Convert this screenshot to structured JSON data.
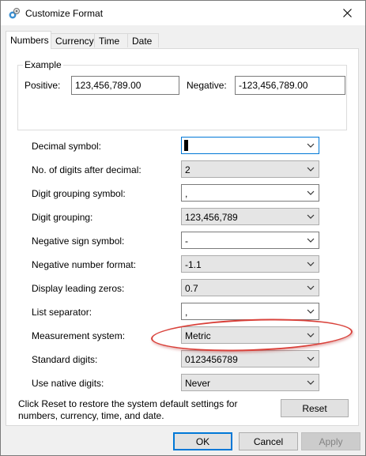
{
  "window": {
    "title": "Customize Format"
  },
  "tabs": [
    {
      "label": "Numbers"
    },
    {
      "label": "Currency"
    },
    {
      "label": "Time"
    },
    {
      "label": "Date"
    }
  ],
  "example": {
    "group_title": "Example",
    "positive_label": "Positive:",
    "positive_value": "123,456,789.00",
    "negative_label": "Negative:",
    "negative_value": "-123,456,789.00"
  },
  "settings": [
    {
      "label": "Decimal symbol:",
      "value": ".",
      "editable": true,
      "focused": true
    },
    {
      "label": "No. of digits after decimal:",
      "value": "2",
      "editable": false
    },
    {
      "label": "Digit grouping symbol:",
      "value": ",",
      "editable": true
    },
    {
      "label": "Digit grouping:",
      "value": "123,456,789",
      "editable": false
    },
    {
      "label": "Negative sign symbol:",
      "value": "-",
      "editable": true
    },
    {
      "label": "Negative number format:",
      "value": "-1.1",
      "editable": false
    },
    {
      "label": "Display leading zeros:",
      "value": "0.7",
      "editable": false
    },
    {
      "label": "List separator:",
      "value": ",",
      "editable": true
    },
    {
      "label": "Measurement system:",
      "value": "Metric",
      "editable": false,
      "highlighted": true
    },
    {
      "label": "Standard digits:",
      "value": "0123456789",
      "editable": false
    },
    {
      "label": "Use native digits:",
      "value": "Never",
      "editable": false
    }
  ],
  "footer": {
    "reset_note": "Click Reset to restore the system default settings for numbers, currency, time, and date.",
    "reset_label": "Reset"
  },
  "buttons": {
    "ok_label": "OK",
    "cancel_label": "Cancel",
    "apply_label": "Apply"
  },
  "colors": {
    "accent": "#0078d7",
    "highlight_ellipse": "#d9413a"
  }
}
